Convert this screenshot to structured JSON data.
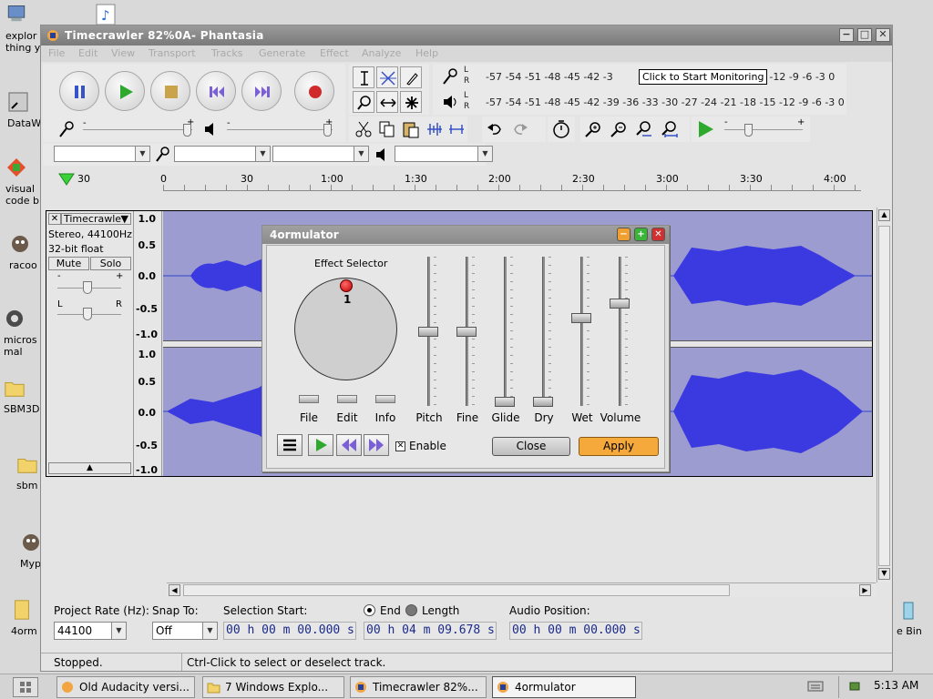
{
  "desktop": {
    "icons": [
      {
        "label": "explor thing y",
        "icon": "computer-icon"
      },
      {
        "label": "DataW",
        "icon": "shortcut-icon"
      },
      {
        "label": "visual code b",
        "icon": "visual-code-icon"
      },
      {
        "label": "racoo",
        "icon": "raccoon-icon"
      },
      {
        "label": "micros mal",
        "icon": "malware-icon"
      },
      {
        "label": "SBM3D",
        "icon": "folder-icon"
      },
      {
        "label": "sbm",
        "icon": "folder-icon"
      },
      {
        "label": "Myp",
        "icon": "raccoon-icon"
      },
      {
        "label": "4orm",
        "icon": "file-icon"
      },
      {
        "label": "e Bin",
        "icon": "recycle-bin-icon"
      }
    ]
  },
  "window": {
    "title": "Timecrawler 82%0A- Phantasia",
    "menu": [
      "File",
      "Edit",
      "View",
      "Transport",
      "Tracks",
      "Generate",
      "Effect",
      "Analyze",
      "Help"
    ]
  },
  "meters": {
    "top_scale": "-57 -54 -51 -48 -45 -42 -3",
    "top_scale_tail": "1 -18 -15 -12 -9 -6 -3 0",
    "tooltip": "Click to Start Monitoring",
    "bottom_scale": "-57 -54 -51 -48 -45 -42 -39 -36 -33 -30 -27 -24 -21 -18 -15 -12 -9 -6 -3 0",
    "lr_top_l": "L",
    "lr_top_r": "R",
    "lr_bottom_l": "L",
    "lr_bottom_r": "R"
  },
  "mixer": {
    "input_minus": "-",
    "input_plus": "+",
    "output_minus": "-",
    "output_plus": "+",
    "speed_minus": "-",
    "speed_plus": "+"
  },
  "timeline": {
    "start_label": "30",
    "ticks": [
      "0",
      "30",
      "1:00",
      "1:30",
      "2:00",
      "2:30",
      "3:00",
      "3:30",
      "4:00"
    ]
  },
  "track": {
    "name": "Timecrawle",
    "info_line1": "Stereo, 44100Hz",
    "info_line2": "32-bit float",
    "mute": "Mute",
    "solo": "Solo",
    "gain_minus": "-",
    "gain_plus": "+",
    "pan_left": "L",
    "pan_right": "R",
    "scale": [
      "1.0",
      "0.5",
      "0.0",
      "-0.5",
      "-1.0"
    ],
    "scale2": [
      "1.0",
      "0.5",
      "0.0",
      "-0.5",
      "-1.0"
    ]
  },
  "dialog": {
    "title": "4ormulator",
    "effect_selector_label": "Effect Selector",
    "selector_value": "1",
    "small_buttons": [
      "File",
      "Edit",
      "Info"
    ],
    "sliders": [
      {
        "label": "Pitch",
        "value": 0.5
      },
      {
        "label": "Fine",
        "value": 0.5
      },
      {
        "label": "Glide",
        "value": 0.0
      },
      {
        "label": "Dry",
        "value": 0.0
      },
      {
        "label": "Wet",
        "value": 0.6
      },
      {
        "label": "Volume",
        "value": 0.7
      }
    ],
    "enable_label": "Enable",
    "enable_checked": true,
    "close_label": "Close",
    "apply_label": "Apply",
    "colors": {
      "apply": "#f5a93a",
      "knob_dot": "#d40000"
    }
  },
  "selection_bar": {
    "project_rate_label": "Project Rate (Hz):",
    "project_rate_value": "44100",
    "snap_to_label": "Snap To:",
    "snap_to_value": "Off",
    "selection_start_label": "Selection Start:",
    "end_label": "End",
    "length_label": "Length",
    "audio_position_label": "Audio Position:",
    "selection_start_value": "00 h 00 m 00.000 s",
    "end_value": "00 h 04 m 09.678 s",
    "audio_position_value": "00 h 00 m 00.000 s"
  },
  "status": {
    "state": "Stopped.",
    "hint": "Ctrl-Click to select or deselect track."
  },
  "taskbar": {
    "tasks": [
      {
        "label": "Old Audacity versi...",
        "icon": "audacity-icon"
      },
      {
        "label": "7 Windows Explo...",
        "icon": "folder-icon"
      },
      {
        "label": "Timecrawler 82%...",
        "icon": "audacity-icon"
      },
      {
        "label": "4ormulator",
        "icon": "audacity-icon"
      }
    ],
    "clock": "5:13 AM"
  }
}
